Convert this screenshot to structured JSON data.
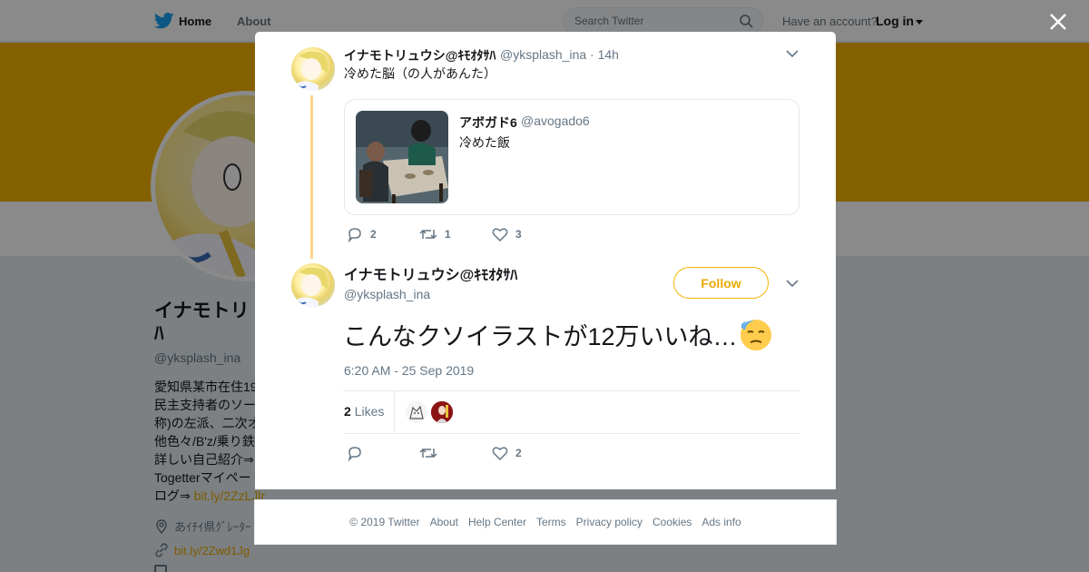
{
  "nav": {
    "home_label": "Home",
    "about_label": "About",
    "search_placeholder": "Search Twitter",
    "have_account": "Have an account?",
    "login_label": "Log in"
  },
  "profile": {
    "name_partial": "イナモトリ\nﾊ",
    "handle": "@yksplash_ina",
    "bio_lines": [
      "愛知県某市在住19",
      "民主支持者のソー",
      "称)の左派、二次オ",
      "他色々/B'z/乗り鉄",
      "詳しい自己紹介⇒",
      "Togetterマイペー",
      "ログ⇒ "
    ],
    "bio_link": "bit.ly/2ZzLJlr",
    "location": "あｲﾁｲ県ｸﾞﾚｰﾀｰ",
    "url": "bit.ly/2Zwd1Jg"
  },
  "colors": {
    "accent": "#f4b400",
    "link": "#e8a900",
    "twitter_blue": "#1da1f2"
  },
  "modal": {
    "parent_tweet": {
      "name": "イナモトリュウシ@ｷﾓｵﾀｻﾊ",
      "handle": "@yksplash_ina",
      "age": "· 14h",
      "text": "冷めた脳（の人があんた）",
      "quote": {
        "name": "アボガド6",
        "handle": "@avogado6",
        "text": "冷めた飯"
      },
      "replies": "2",
      "retweets": "1",
      "likes": "3"
    },
    "main_tweet": {
      "name": "イナモトリュウシ@ｷﾓｵﾀｻﾊ",
      "handle": "@yksplash_ina",
      "follow_label": "Follow",
      "text": "こんなクソイラストが12万いいね…",
      "emoji": "downcast-face-with-sweat",
      "timestamp": "6:20 AM - 25 Sep 2019",
      "likes_count": "2",
      "likes_label": "Likes",
      "like_action_count": "2"
    }
  },
  "footer": {
    "links": [
      "© 2019 Twitter",
      "About",
      "Help Center",
      "Terms",
      "Privacy policy",
      "Cookies",
      "Ads info"
    ]
  }
}
